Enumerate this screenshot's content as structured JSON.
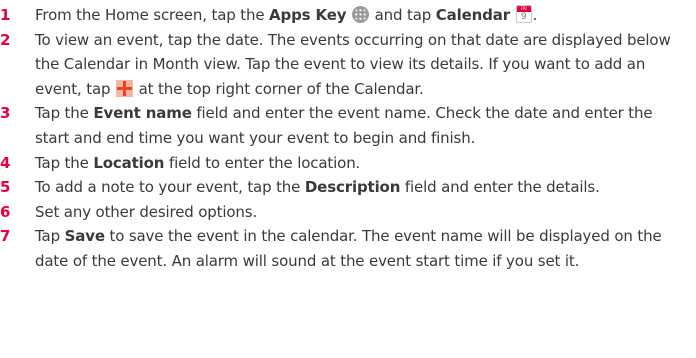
{
  "accent_color": "#e2003c",
  "steps": [
    {
      "number": "1",
      "text_a": "From the Home screen, tap the ",
      "bold_a": "Apps Key",
      "text_b": " and tap ",
      "bold_b": "Calendar",
      "text_c": "."
    },
    {
      "number": "2",
      "text_a": "To view an event, tap the date. The events occurring on that date are displayed below the Calendar in Month view. Tap the event to view its details. If you want to add an event, tap ",
      "text_b": " at the top right corner of the Calendar."
    },
    {
      "number": "3",
      "text_a": "Tap the ",
      "bold_a": "Event name",
      "text_b": " field and enter the event name. Check the date and enter the start and end time you want your event to begin and finish."
    },
    {
      "number": "4",
      "text_a": "Tap the ",
      "bold_a": "Location",
      "text_b": " field to enter the location."
    },
    {
      "number": "5",
      "text_a": "To add a note to your event, tap the ",
      "bold_a": "Description",
      "text_b": " field and enter the details."
    },
    {
      "number": "6",
      "text_a": "Set any other desired options."
    },
    {
      "number": "7",
      "text_a": "Tap ",
      "bold_a": "Save",
      "text_b": " to save the event in the calendar. The event name will be displayed on the date of the event. An alarm will sound at the event start time if you set it."
    }
  ],
  "icons": {
    "apps_key": "apps-key-icon",
    "calendar": "calendar-app-icon",
    "add": "add-plus-icon"
  },
  "calendar_icon": {
    "header": "FRI",
    "day": "9"
  }
}
